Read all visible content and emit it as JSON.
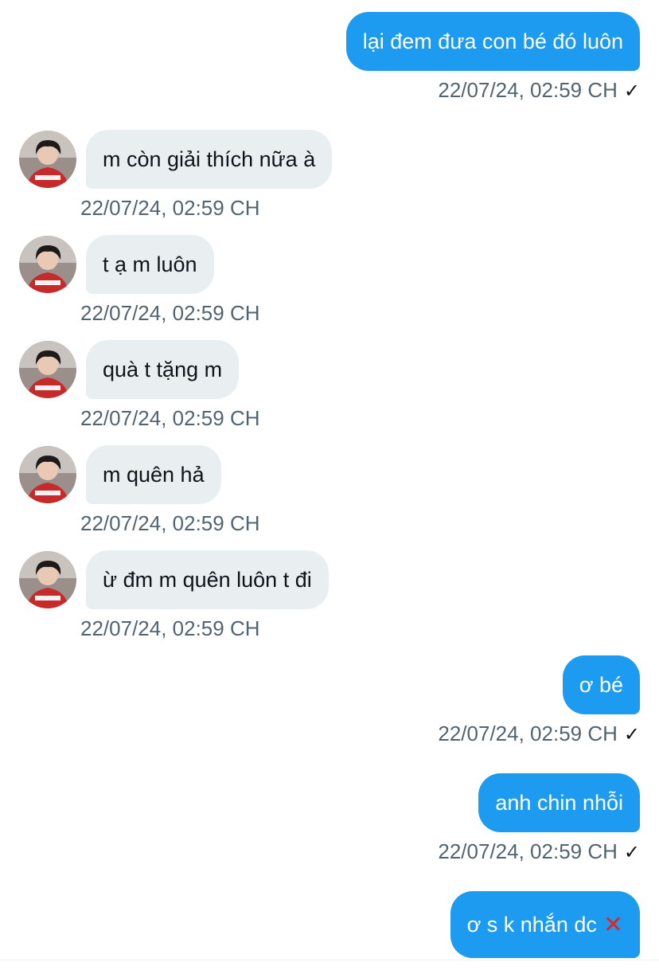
{
  "messages": [
    {
      "text": "lại đem đưa con bé đó luôn",
      "time": "22/07/24, 02:59 CH",
      "check": "✓"
    },
    {
      "text": "m còn giải thích nữa à",
      "time": "22/07/24, 02:59 CH"
    },
    {
      "text": "t ạ m luôn",
      "time": "22/07/24, 02:59 CH"
    },
    {
      "text": "quà t tặng m",
      "time": "22/07/24, 02:59 CH"
    },
    {
      "text": "m quên hả",
      "time": "22/07/24, 02:59 CH"
    },
    {
      "text": "ừ đm m quên luôn t đi",
      "time": "22/07/24, 02:59 CH"
    },
    {
      "text": "ơ bé",
      "time": "22/07/24, 02:59 CH",
      "check": "✓"
    },
    {
      "text": "anh chin nhỗi",
      "time": "22/07/24, 02:59 CH",
      "check": "✓"
    },
    {
      "text": "ơ s k nhắn dc",
      "emoji": "✕",
      "emoji_icon": "cross-mark-icon"
    }
  ],
  "colors": {
    "outgoing_bubble": "#1d9bf0",
    "incoming_bubble": "#e9eef1",
    "timestamp": "#536471",
    "cross_mark": "#e02424"
  }
}
